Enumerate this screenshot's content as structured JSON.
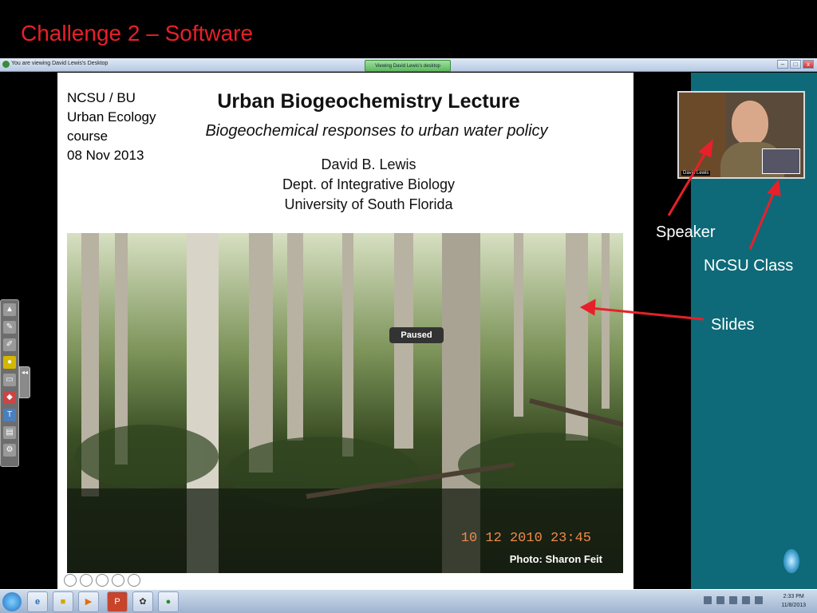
{
  "slide": {
    "title": "Challenge 2 – Software"
  },
  "window": {
    "title": "You are viewing David Lewis's Desktop",
    "viewing_tab": "Viewing David Lewis's desktop",
    "controls": {
      "minimize": "–",
      "maximize": "□",
      "close": "x"
    }
  },
  "lecture": {
    "course_lines": [
      "NCSU / BU",
      "Urban Ecology",
      "course",
      "08 Nov 2013"
    ],
    "title": "Urban Biogeochemistry Lecture",
    "subtitle": "Biogeochemical responses to urban water policy",
    "author_lines": [
      "David B. Lewis",
      "Dept. of Integrative Biology",
      "University of South Florida"
    ],
    "paused_label": "Paused",
    "date_stamp": "10 12 2010  23:45",
    "photo_credit": "Photo: Sharon Feit"
  },
  "video": {
    "label": "David Lewis"
  },
  "annotations": {
    "speaker": "Speaker",
    "class": "NCSU Class",
    "slides": "Slides"
  },
  "annotation_color": "#e8202a",
  "toolbar": {
    "icons": [
      "pointer-icon",
      "pen-icon",
      "highlighter-icon",
      "marker-icon",
      "eraser-icon",
      "shape-icon",
      "text-icon",
      "keyboard-icon",
      "settings-icon"
    ],
    "collapse": "◂◂"
  },
  "taskbar": {
    "apps": [
      "ie-icon",
      "folder-icon",
      "media-player-icon",
      "powerpoint-icon",
      "app-icon",
      "globe-icon"
    ],
    "clock_time": "2:33 PM",
    "clock_date": "11/8/2013"
  },
  "colors": {
    "title_red": "#e8202a",
    "panel_teal": "#0e6a78"
  }
}
